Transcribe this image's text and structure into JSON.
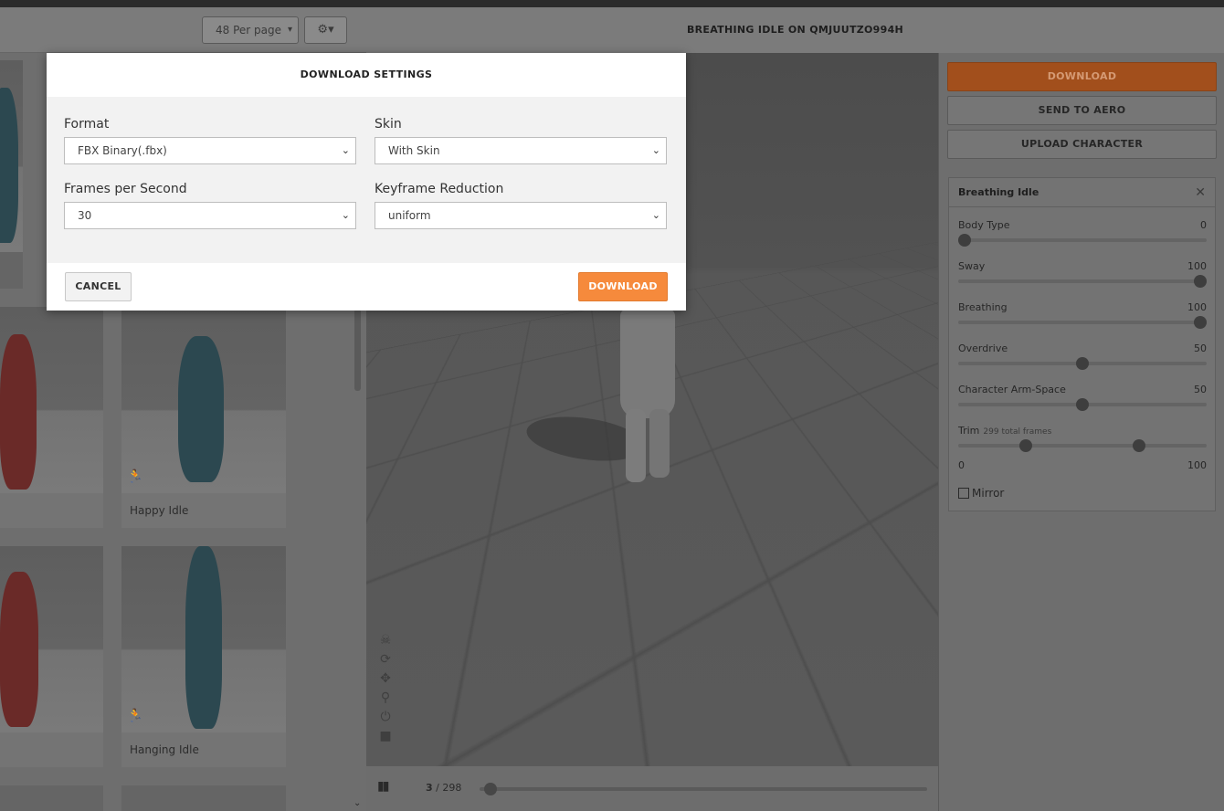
{
  "library": {
    "per_page": "48 Per page",
    "gear_caret": "▾",
    "cards": [
      {
        "label": ""
      },
      {
        "label": "Happy Idle"
      },
      {
        "label": ""
      },
      {
        "label": "Hanging Idle"
      }
    ]
  },
  "viewer": {
    "title": "BREATHING IDLE ON QMJUUTZO994H",
    "frame_current": "3",
    "frame_total": "/ 298",
    "timeline_progress": 0.01
  },
  "right_panel": {
    "download_label": "DOWNLOAD",
    "send_label": "SEND TO AERO",
    "upload_label": "UPLOAD CHARACTER",
    "settings_title": "Breathing Idle",
    "sliders": [
      {
        "label": "Body Type",
        "value": "0",
        "fraction": 0
      },
      {
        "label": "Sway",
        "value": "100",
        "fraction": 1
      },
      {
        "label": "Breathing",
        "value": "100",
        "fraction": 1
      },
      {
        "label": "Overdrive",
        "value": "50",
        "fraction": 0.5
      },
      {
        "label": "Character Arm-Space",
        "value": "50",
        "fraction": 0.5
      }
    ],
    "trim": {
      "label": "Trim",
      "note": "299 total frames",
      "start_fraction": 0.26,
      "end_fraction": 0.74,
      "min": "0",
      "max": "100"
    },
    "mirror_label": "Mirror"
  },
  "modal": {
    "title": "DOWNLOAD SETTINGS",
    "format_label": "Format",
    "format_value": "FBX Binary(.fbx)",
    "skin_label": "Skin",
    "skin_value": "With Skin",
    "fps_label": "Frames per Second",
    "fps_value": "30",
    "keyframe_label": "Keyframe Reduction",
    "keyframe_value": "uniform",
    "cancel_label": "CANCEL",
    "download_label": "DOWNLOAD"
  },
  "colors": {
    "accent": "#f68a3c",
    "accent_dimmed": "#a24f1c"
  }
}
